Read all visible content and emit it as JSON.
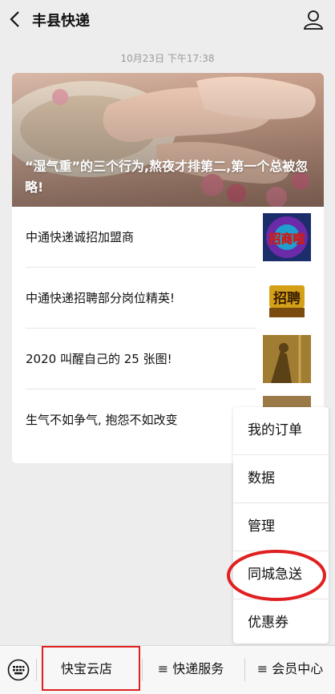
{
  "header": {
    "title": "丰县快递",
    "back_icon": "chevron-left-icon",
    "profile_icon": "user-icon"
  },
  "timestamp": "10月23日 下午17:38",
  "cover": {
    "title": "“湿气重”的三个行为,熬夜才排第二,第一个总被忽略!"
  },
  "articles": [
    {
      "title": "中通快递诚招加盟商",
      "thumb_text": "招商啦"
    },
    {
      "title": "中通快递招聘部分岗位精英!",
      "thumb_text": "招聘"
    },
    {
      "title": "2020 叫醒自己的 25 张图!"
    },
    {
      "title": "生气不如争气, 抱怨不如改变"
    }
  ],
  "popup_menu": {
    "items": [
      "我的订单",
      "数据",
      "管理",
      "同城急送",
      "优惠券"
    ],
    "highlighted_item": "同城急送"
  },
  "bottom_bar": {
    "keyboard_icon": "keyboard-icon",
    "tabs": [
      "快宝云店",
      "≡ 快递服务",
      "≡ 会员中心"
    ]
  },
  "colors": {
    "background": "#ededed",
    "annotation_red": "#e02020"
  }
}
